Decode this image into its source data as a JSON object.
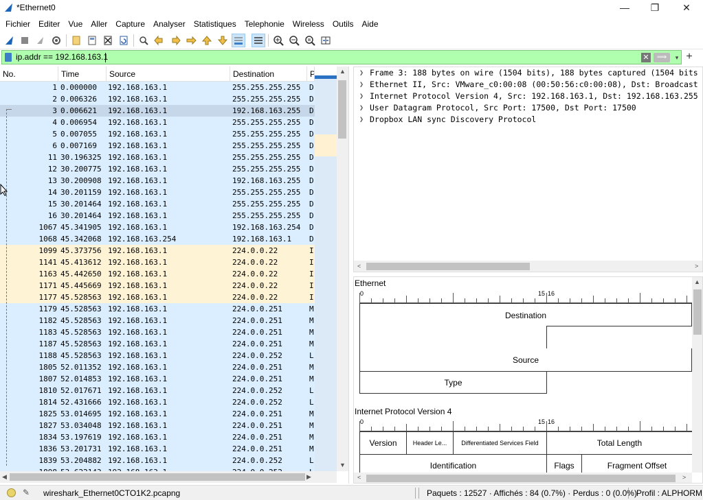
{
  "window": {
    "title": "*Ethernet0",
    "min_glyph": "—",
    "max_glyph": "❐",
    "close_glyph": "✕"
  },
  "menu": [
    "Fichier",
    "Editer",
    "Vue",
    "Aller",
    "Capture",
    "Analyser",
    "Statistiques",
    "Telephonie",
    "Wireless",
    "Outils",
    "Aide"
  ],
  "toolbar_icons": [
    "shark-fin-start-icon",
    "stop-icon",
    "restart-icon",
    "options-gear-icon",
    "open-file-icon",
    "save-file-icon",
    "close-file-icon",
    "reload-icon",
    "find-packet-icon",
    "go-back-icon",
    "go-forward-icon",
    "go-to-packet-icon",
    "go-first-icon",
    "go-last-icon",
    "autoscroll-icon",
    "colorize-icon",
    "zoom-in-icon",
    "zoom-out-icon",
    "zoom-normal-icon",
    "resize-columns-icon"
  ],
  "filter": {
    "value": "ip.addr == 192.168.163.1",
    "clear_glyph": "✕",
    "apply_glyph": "⟹",
    "dropdown_glyph": "▾",
    "add_glyph": "+",
    "bg_color": "#afffaf"
  },
  "packet_list": {
    "columns": [
      "No.",
      "Time",
      "Source",
      "Destination",
      "P"
    ],
    "selected_row": 2,
    "rows": [
      {
        "no": "1",
        "time": "0.000000",
        "src": "192.168.163.1",
        "dst": "255.255.255.255",
        "p": "D",
        "color": "#daeeff"
      },
      {
        "no": "2",
        "time": "0.006326",
        "src": "192.168.163.1",
        "dst": "255.255.255.255",
        "p": "D",
        "color": "#daeeff"
      },
      {
        "no": "3",
        "time": "0.006621",
        "src": "192.168.163.1",
        "dst": "192.168.163.255",
        "p": "D",
        "color": "#c5d7e8"
      },
      {
        "no": "4",
        "time": "0.006954",
        "src": "192.168.163.1",
        "dst": "255.255.255.255",
        "p": "D",
        "color": "#daeeff"
      },
      {
        "no": "5",
        "time": "0.007055",
        "src": "192.168.163.1",
        "dst": "255.255.255.255",
        "p": "D",
        "color": "#daeeff"
      },
      {
        "no": "6",
        "time": "0.007169",
        "src": "192.168.163.1",
        "dst": "255.255.255.255",
        "p": "D",
        "color": "#daeeff"
      },
      {
        "no": "11",
        "time": "30.196325",
        "src": "192.168.163.1",
        "dst": "255.255.255.255",
        "p": "D",
        "color": "#daeeff"
      },
      {
        "no": "12",
        "time": "30.200775",
        "src": "192.168.163.1",
        "dst": "255.255.255.255",
        "p": "D",
        "color": "#daeeff"
      },
      {
        "no": "13",
        "time": "30.200908",
        "src": "192.168.163.1",
        "dst": "192.168.163.255",
        "p": "D",
        "color": "#daeeff"
      },
      {
        "no": "14",
        "time": "30.201159",
        "src": "192.168.163.1",
        "dst": "255.255.255.255",
        "p": "D",
        "color": "#daeeff"
      },
      {
        "no": "15",
        "time": "30.201464",
        "src": "192.168.163.1",
        "dst": "255.255.255.255",
        "p": "D",
        "color": "#daeeff"
      },
      {
        "no": "16",
        "time": "30.201464",
        "src": "192.168.163.1",
        "dst": "255.255.255.255",
        "p": "D",
        "color": "#daeeff"
      },
      {
        "no": "1067",
        "time": "45.341905",
        "src": "192.168.163.1",
        "dst": "192.168.163.254",
        "p": "D",
        "color": "#daeeff"
      },
      {
        "no": "1068",
        "time": "45.342068",
        "src": "192.168.163.254",
        "dst": "192.168.163.1",
        "p": "D",
        "color": "#daeeff"
      },
      {
        "no": "1099",
        "time": "45.373756",
        "src": "192.168.163.1",
        "dst": "224.0.0.22",
        "p": "I",
        "color": "#fff3d6"
      },
      {
        "no": "1141",
        "time": "45.413612",
        "src": "192.168.163.1",
        "dst": "224.0.0.22",
        "p": "I",
        "color": "#fff3d6"
      },
      {
        "no": "1163",
        "time": "45.442650",
        "src": "192.168.163.1",
        "dst": "224.0.0.22",
        "p": "I",
        "color": "#fff3d6"
      },
      {
        "no": "1171",
        "time": "45.445669",
        "src": "192.168.163.1",
        "dst": "224.0.0.22",
        "p": "I",
        "color": "#fff3d6"
      },
      {
        "no": "1177",
        "time": "45.528563",
        "src": "192.168.163.1",
        "dst": "224.0.0.22",
        "p": "I",
        "color": "#fff3d6"
      },
      {
        "no": "1179",
        "time": "45.528563",
        "src": "192.168.163.1",
        "dst": "224.0.0.251",
        "p": "M",
        "color": "#daeeff"
      },
      {
        "no": "1182",
        "time": "45.528563",
        "src": "192.168.163.1",
        "dst": "224.0.0.251",
        "p": "M",
        "color": "#daeeff"
      },
      {
        "no": "1183",
        "time": "45.528563",
        "src": "192.168.163.1",
        "dst": "224.0.0.251",
        "p": "M",
        "color": "#daeeff"
      },
      {
        "no": "1187",
        "time": "45.528563",
        "src": "192.168.163.1",
        "dst": "224.0.0.251",
        "p": "M",
        "color": "#daeeff"
      },
      {
        "no": "1188",
        "time": "45.528563",
        "src": "192.168.163.1",
        "dst": "224.0.0.252",
        "p": "L",
        "color": "#daeeff"
      },
      {
        "no": "1805",
        "time": "52.011352",
        "src": "192.168.163.1",
        "dst": "224.0.0.251",
        "p": "M",
        "color": "#daeeff"
      },
      {
        "no": "1807",
        "time": "52.014853",
        "src": "192.168.163.1",
        "dst": "224.0.0.251",
        "p": "M",
        "color": "#daeeff"
      },
      {
        "no": "1810",
        "time": "52.017671",
        "src": "192.168.163.1",
        "dst": "224.0.0.252",
        "p": "L",
        "color": "#daeeff"
      },
      {
        "no": "1814",
        "time": "52.431666",
        "src": "192.168.163.1",
        "dst": "224.0.0.252",
        "p": "L",
        "color": "#daeeff"
      },
      {
        "no": "1825",
        "time": "53.014695",
        "src": "192.168.163.1",
        "dst": "224.0.0.251",
        "p": "M",
        "color": "#daeeff"
      },
      {
        "no": "1827",
        "time": "53.034048",
        "src": "192.168.163.1",
        "dst": "224.0.0.251",
        "p": "M",
        "color": "#daeeff"
      },
      {
        "no": "1834",
        "time": "53.197619",
        "src": "192.168.163.1",
        "dst": "224.0.0.251",
        "p": "M",
        "color": "#daeeff"
      },
      {
        "no": "1836",
        "time": "53.201731",
        "src": "192.168.163.1",
        "dst": "224.0.0.251",
        "p": "M",
        "color": "#daeeff"
      },
      {
        "no": "1839",
        "time": "53.204882",
        "src": "192.168.163.1",
        "dst": "224.0.0.252",
        "p": "L",
        "color": "#daeeff"
      },
      {
        "no": "1898",
        "time": "53.622143",
        "src": "192.168.163.1",
        "dst": "224.0.0.252",
        "p": "L",
        "color": "#daeeff"
      }
    ]
  },
  "details": [
    "Frame 3: 188 bytes on wire (1504 bits), 188 bytes captured (1504 bits",
    "Ethernet II, Src: VMware_c0:00:08 (00:50:56:c0:00:08), Dst: Broadcast",
    "Internet Protocol Version 4, Src: 192.168.163.1, Dst: 192.168.163.255",
    "User Datagram Protocol, Src Port: 17500, Dst Port: 17500",
    "Dropbox LAN sync Discovery Protocol"
  ],
  "diagram": {
    "ethernet_title": "Ethernet",
    "ipv4_title": "Internet Protocol Version 4",
    "ruler_start": "0",
    "ruler_15": "15",
    "ruler_16": "16",
    "eth_fields": {
      "destination": "Destination",
      "source": "Source",
      "type": "Type"
    },
    "ip_fields": {
      "version": "Version",
      "header_len": "Header Le...",
      "dsf": "Differentiated Services Field",
      "total_len": "Total Length",
      "identification": "Identification",
      "flags": "Flags",
      "frag_offset": "Fragment Offset"
    }
  },
  "status": {
    "file": "wireshark_Ethernet0CTO1K2.pcapng",
    "packets": "Paquets : 12527 · Affichés : 84 (0.7%) · Perdus : 0 (0.0%)",
    "profile": "Profil : ALPHORM"
  }
}
